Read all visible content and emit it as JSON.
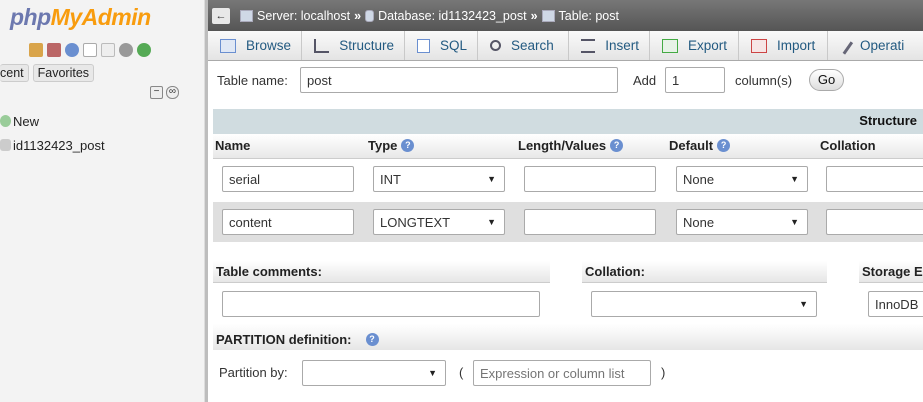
{
  "sidebar": {
    "logo_php": "php",
    "logo_admin": "MyAdmin",
    "tab_recent": "cent",
    "tab_favorites": "Favorites",
    "tree": [
      {
        "label": "New",
        "icon": "new-db-icon"
      },
      {
        "label": "id1132423_post",
        "icon": "database-icon"
      }
    ]
  },
  "breadcrumb": {
    "server": "Server: localhost",
    "database": "Database: id1132423_post",
    "table": "Table: post",
    "separator": "»"
  },
  "menu": [
    {
      "label": "Browse",
      "icon": "browse-icon"
    },
    {
      "label": "Structure",
      "icon": "structure-icon"
    },
    {
      "label": "SQL",
      "icon": "sql-icon"
    },
    {
      "label": "Search",
      "icon": "search-icon"
    },
    {
      "label": "Insert",
      "icon": "insert-icon"
    },
    {
      "label": "Export",
      "icon": "export-icon"
    },
    {
      "label": "Import",
      "icon": "import-icon"
    },
    {
      "label": "Operati",
      "icon": "wrench-icon"
    }
  ],
  "form": {
    "table_name_label": "Table name:",
    "table_name_value": "post",
    "add_label": "Add",
    "add_value": "1",
    "columns_label": "column(s)",
    "go_label": "Go",
    "structure_heading": "Structure"
  },
  "columns_header": {
    "name": "Name",
    "type": "Type",
    "length": "Length/Values",
    "default": "Default",
    "collation": "Collation"
  },
  "rows": [
    {
      "name": "serial",
      "type": "INT",
      "length": "",
      "default": "None"
    },
    {
      "name": "content",
      "type": "LONGTEXT",
      "length": "",
      "default": "None"
    }
  ],
  "table_options": {
    "comments_label": "Table comments:",
    "collation_label": "Collation:",
    "storage_label": "Storage E",
    "storage_value": "InnoDB"
  },
  "partition": {
    "heading": "PARTITION definition:",
    "by_label": "Partition by:",
    "open_paren": "(",
    "close_paren": ")",
    "expression_placeholder": "Expression or column list"
  },
  "colors": {
    "topbar": "#666666",
    "link": "#235a81",
    "structure_header": "#d0dce0",
    "help_icon": "#6a8fd0"
  }
}
